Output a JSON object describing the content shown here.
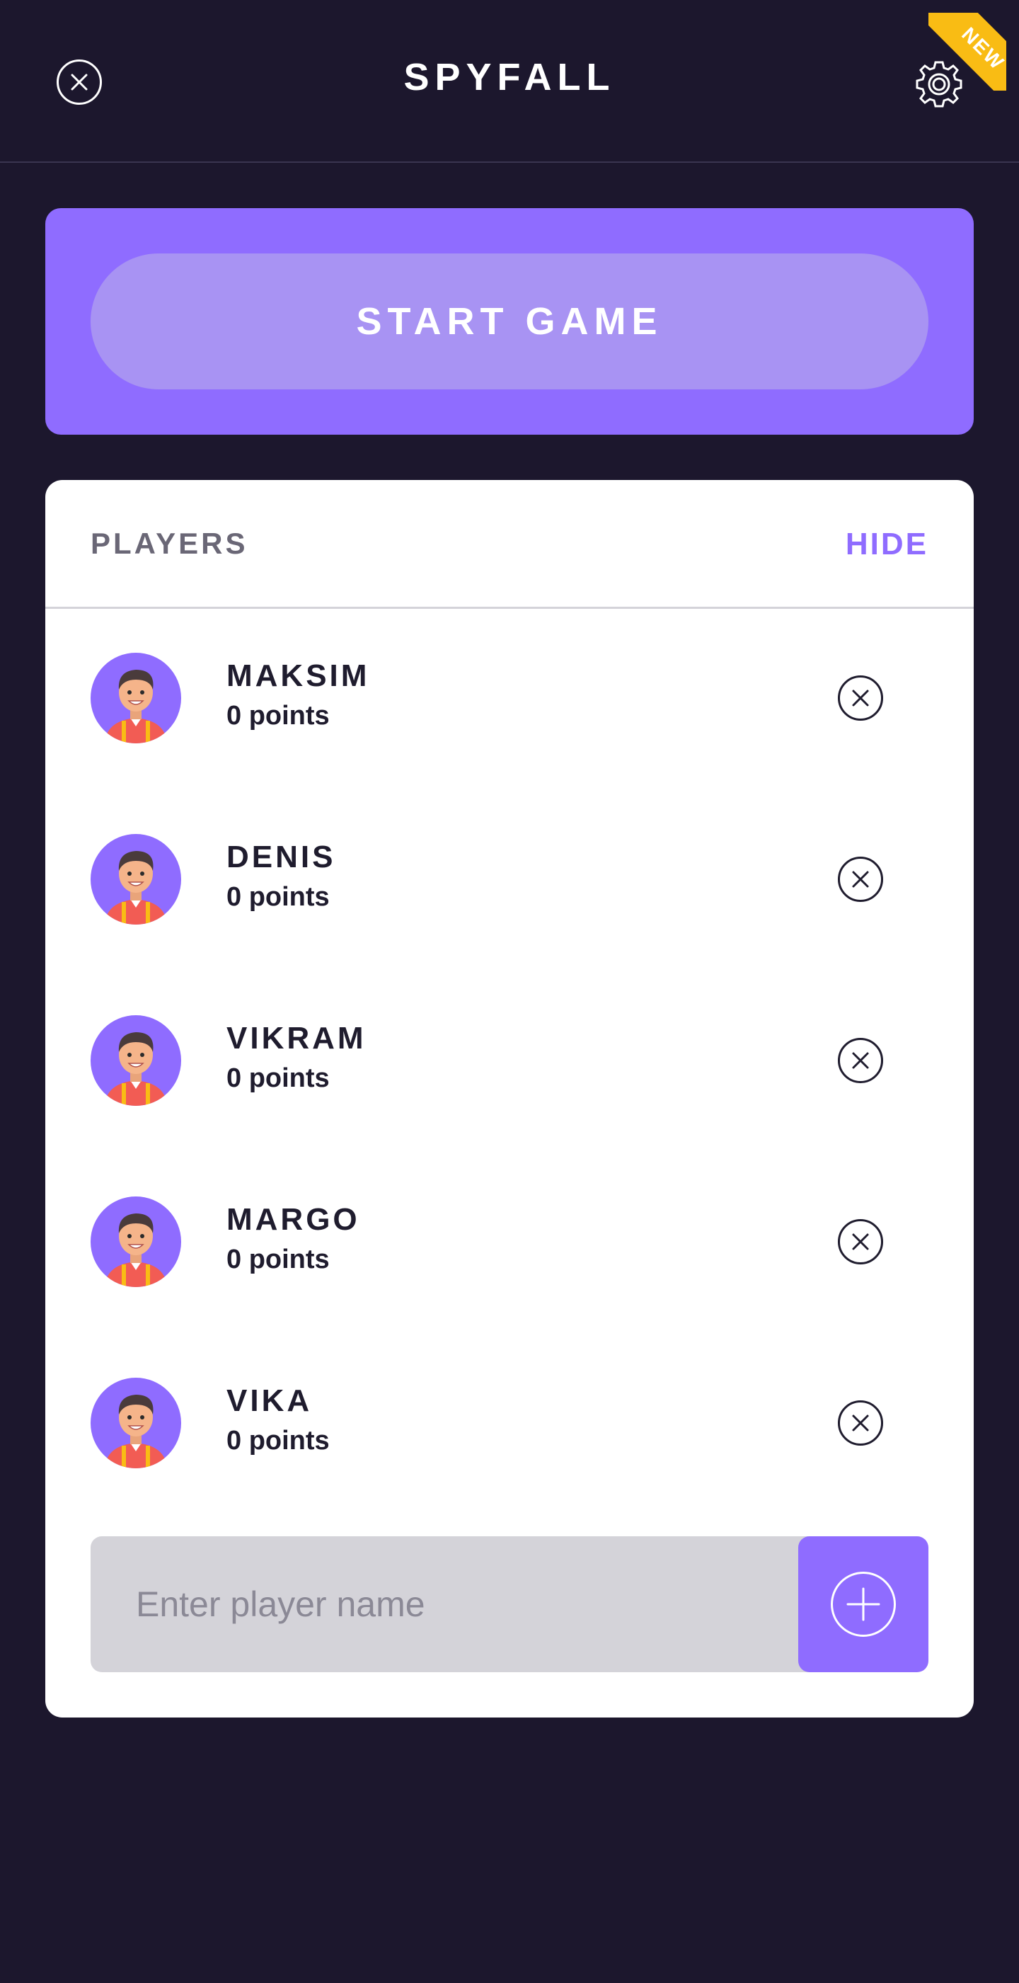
{
  "header": {
    "title": "SPYFALL",
    "close_icon": "close-icon",
    "settings_icon": "gear-icon",
    "badge": "NEW"
  },
  "start": {
    "label": "START GAME"
  },
  "players": {
    "title": "PLAYERS",
    "toggle_label": "HIDE",
    "items": [
      {
        "name": "MAKSIM",
        "points": "0 points"
      },
      {
        "name": "DENIS",
        "points": "0 points"
      },
      {
        "name": "VIKRAM",
        "points": "0 points"
      },
      {
        "name": "MARGO",
        "points": "0 points"
      },
      {
        "name": "VIKA",
        "points": "0 points"
      }
    ]
  },
  "add_player": {
    "placeholder": "Enter player name",
    "value": "",
    "icon": "plus-icon"
  },
  "colors": {
    "background": "#1c172d",
    "accent": "#8f6cff",
    "accent_light": "#a893f3",
    "badge": "#f9bc14",
    "input_bg": "#d4d3d9"
  }
}
